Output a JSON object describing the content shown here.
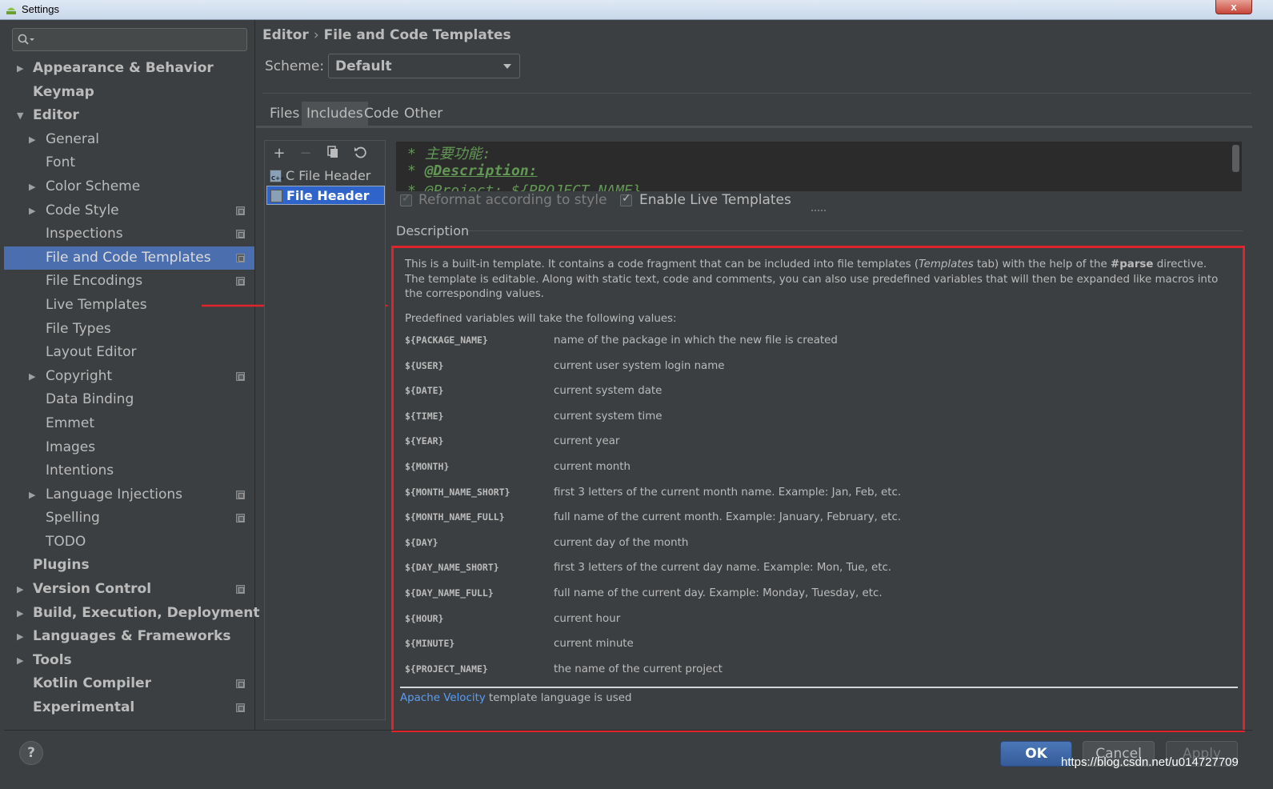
{
  "window": {
    "title": "Settings",
    "close_label": "x"
  },
  "search": {
    "placeholder": ""
  },
  "sidebar": {
    "items": [
      {
        "label": "Appearance & Behavior",
        "indent": 0,
        "expandable": true,
        "expanded": false,
        "bold": true,
        "project_icon": false
      },
      {
        "label": "Keymap",
        "indent": 0,
        "expandable": false,
        "bold": true,
        "project_icon": false
      },
      {
        "label": "Editor",
        "indent": 0,
        "expandable": true,
        "expanded": true,
        "bold": true,
        "project_icon": false
      },
      {
        "label": "General",
        "indent": 1,
        "expandable": true,
        "expanded": false,
        "bold": false,
        "project_icon": false
      },
      {
        "label": "Font",
        "indent": 1,
        "expandable": false,
        "bold": false,
        "project_icon": false
      },
      {
        "label": "Color Scheme",
        "indent": 1,
        "expandable": true,
        "expanded": false,
        "bold": false,
        "project_icon": false
      },
      {
        "label": "Code Style",
        "indent": 1,
        "expandable": true,
        "expanded": false,
        "bold": false,
        "project_icon": true
      },
      {
        "label": "Inspections",
        "indent": 1,
        "expandable": false,
        "bold": false,
        "project_icon": true
      },
      {
        "label": "File and Code Templates",
        "indent": 1,
        "expandable": false,
        "bold": false,
        "project_icon": true,
        "selected": true
      },
      {
        "label": "File Encodings",
        "indent": 1,
        "expandable": false,
        "bold": false,
        "project_icon": true
      },
      {
        "label": "Live Templates",
        "indent": 1,
        "expandable": false,
        "bold": false,
        "project_icon": false
      },
      {
        "label": "File Types",
        "indent": 1,
        "expandable": false,
        "bold": false,
        "project_icon": false
      },
      {
        "label": "Layout Editor",
        "indent": 1,
        "expandable": false,
        "bold": false,
        "project_icon": false
      },
      {
        "label": "Copyright",
        "indent": 1,
        "expandable": true,
        "expanded": false,
        "bold": false,
        "project_icon": true
      },
      {
        "label": "Data Binding",
        "indent": 1,
        "expandable": false,
        "bold": false,
        "project_icon": false
      },
      {
        "label": "Emmet",
        "indent": 1,
        "expandable": false,
        "bold": false,
        "project_icon": false
      },
      {
        "label": "Images",
        "indent": 1,
        "expandable": false,
        "bold": false,
        "project_icon": false
      },
      {
        "label": "Intentions",
        "indent": 1,
        "expandable": false,
        "bold": false,
        "project_icon": false
      },
      {
        "label": "Language Injections",
        "indent": 1,
        "expandable": true,
        "expanded": false,
        "bold": false,
        "project_icon": true
      },
      {
        "label": "Spelling",
        "indent": 1,
        "expandable": false,
        "bold": false,
        "project_icon": true
      },
      {
        "label": "TODO",
        "indent": 1,
        "expandable": false,
        "bold": false,
        "project_icon": false
      },
      {
        "label": "Plugins",
        "indent": 0,
        "expandable": false,
        "bold": true,
        "project_icon": false
      },
      {
        "label": "Version Control",
        "indent": 0,
        "expandable": true,
        "expanded": false,
        "bold": true,
        "project_icon": true
      },
      {
        "label": "Build, Execution, Deployment",
        "indent": 0,
        "expandable": true,
        "expanded": false,
        "bold": true,
        "project_icon": false
      },
      {
        "label": "Languages & Frameworks",
        "indent": 0,
        "expandable": true,
        "expanded": false,
        "bold": true,
        "project_icon": false
      },
      {
        "label": "Tools",
        "indent": 0,
        "expandable": true,
        "expanded": false,
        "bold": true,
        "project_icon": false
      },
      {
        "label": "Kotlin Compiler",
        "indent": 0,
        "expandable": false,
        "bold": true,
        "project_icon": true
      },
      {
        "label": "Experimental",
        "indent": 0,
        "expandable": false,
        "bold": true,
        "project_icon": true
      }
    ]
  },
  "breadcrumb": {
    "parent": "Editor",
    "separator": "›",
    "current": "File and Code Templates"
  },
  "scheme": {
    "label": "Scheme:",
    "value": "Default"
  },
  "tabs": [
    "Files",
    "Includes",
    "Code",
    "Other"
  ],
  "active_tab": "Includes",
  "templates": [
    {
      "name": "C File Header",
      "icon_text": "C++",
      "selected": false
    },
    {
      "name": "File Header",
      "icon_text": "",
      "selected": true
    }
  ],
  "editor": {
    "lines": [
      {
        "prefix": " * ",
        "text": "主要功能:",
        "tag": false
      },
      {
        "prefix": " * ",
        "text": "@Description:",
        "tag": true
      },
      {
        "prefix": " * ",
        "text": "@Project: ${PROJECT_NAME}",
        "tag": false
      }
    ]
  },
  "options": {
    "reformat": {
      "label": "Reformat according to style",
      "checked": true,
      "enabled": false
    },
    "live_templates": {
      "label": "Enable Live Templates",
      "checked": true,
      "enabled": true
    }
  },
  "description": {
    "title": "Description",
    "intro_1": "This is a built-in template. It contains a code fragment that can be included into file templates (",
    "intro_templates": "Templates",
    "intro_2": " tab) with the help of the ",
    "intro_parse": "#parse",
    "intro_3": " directive.",
    "intro_4": "The template is editable. Along with static text, code and comments, you can also use predefined variables that will then be expanded like macros into the corresponding values.",
    "vars_heading": "Predefined variables will take the following values:",
    "variables": [
      {
        "name": "${PACKAGE_NAME}",
        "desc": "name of the package in which the new file is created"
      },
      {
        "name": "${USER}",
        "desc": "current user system login name"
      },
      {
        "name": "${DATE}",
        "desc": "current system date"
      },
      {
        "name": "${TIME}",
        "desc": "current system time"
      },
      {
        "name": "${YEAR}",
        "desc": "current year"
      },
      {
        "name": "${MONTH}",
        "desc": "current month"
      },
      {
        "name": "${MONTH_NAME_SHORT}",
        "desc": "first 3 letters of the current month name. Example: Jan, Feb, etc."
      },
      {
        "name": "${MONTH_NAME_FULL}",
        "desc": "full name of the current month. Example: January, February, etc."
      },
      {
        "name": "${DAY}",
        "desc": "current day of the month"
      },
      {
        "name": "${DAY_NAME_SHORT}",
        "desc": "first 3 letters of the current day name. Example: Mon, Tue, etc."
      },
      {
        "name": "${DAY_NAME_FULL}",
        "desc": "full name of the current day. Example: Monday, Tuesday, etc."
      },
      {
        "name": "${HOUR}",
        "desc": "current hour"
      },
      {
        "name": "${MINUTE}",
        "desc": "current minute"
      },
      {
        "name": "${PROJECT_NAME}",
        "desc": "the name of the current project"
      }
    ],
    "velocity_link": "Apache Velocity",
    "velocity_text": " template language is used"
  },
  "buttons": {
    "help": "?",
    "ok": "OK",
    "cancel": "Cancel",
    "apply": "Apply"
  },
  "watermark": "https://blog.csdn.net/u014727709",
  "colors": {
    "accent": "#4b6eaf",
    "highlight_box": "#e0242c",
    "link": "#589df6",
    "comment_green": "#629755"
  }
}
